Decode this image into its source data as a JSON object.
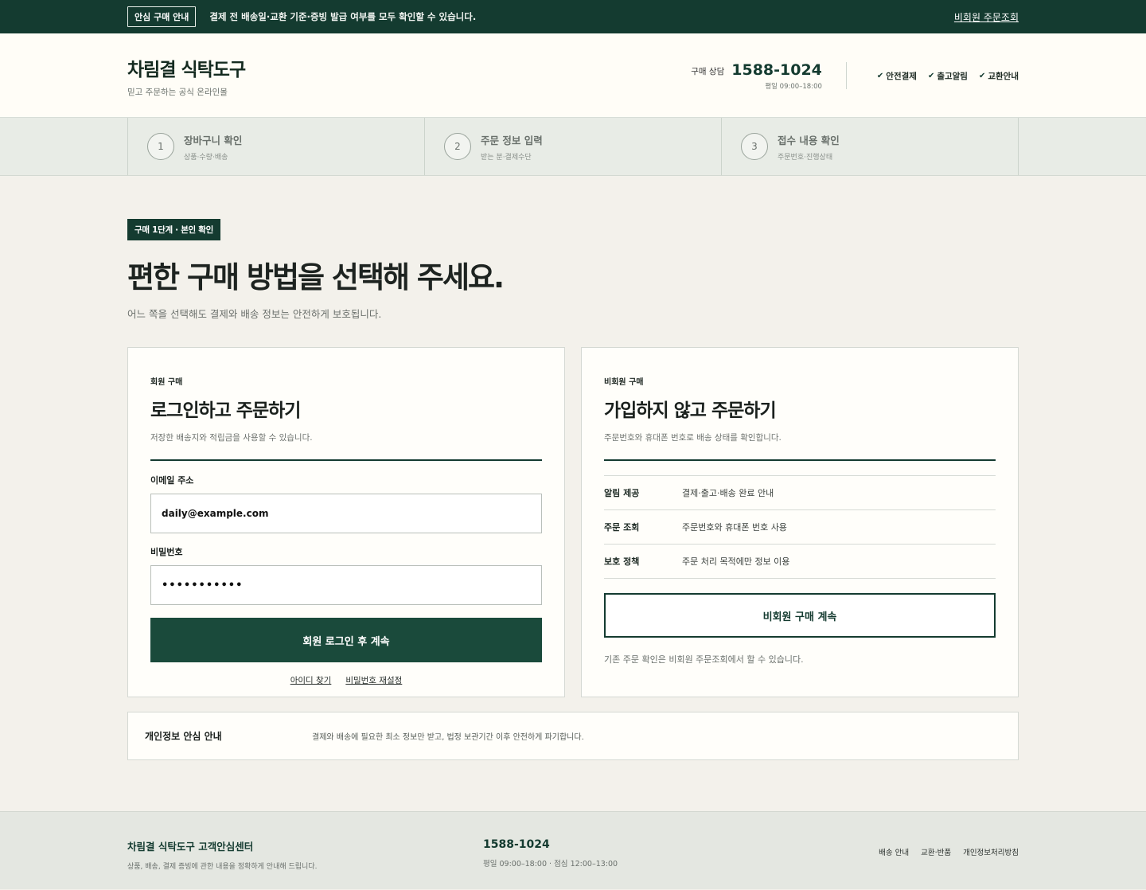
{
  "topbar": {
    "badge": "안심 구매 안내",
    "text": "결제 전 배송일·교환 기준·증빙 발급 여부를 모두 확인할 수 있습니다.",
    "link": "비회원 주문조회"
  },
  "header": {
    "brand_name": "차림결 식탁도구",
    "brand_sub": "믿고 주문하는 공식 온라인몰",
    "contact_label": "구매 상담",
    "contact_number": "1588-1024",
    "contact_hours": "평일 09:00–18:00",
    "checks": [
      "안전결제",
      "출고알림",
      "교환안내"
    ]
  },
  "steps": [
    {
      "num": "1",
      "title": "장바구니 확인",
      "sub": "상품·수량·배송"
    },
    {
      "num": "2",
      "title": "주문 정보 입력",
      "sub": "받는 분·결제수단"
    },
    {
      "num": "3",
      "title": "접수 내용 확인",
      "sub": "주문번호·진행상태"
    }
  ],
  "main": {
    "stage_badge": "구매 1단계 · 본인 확인",
    "title": "편한 구매 방법을 선택해 주세요.",
    "subtitle": "어느 쪽을 선택해도 결제와 배송 정보는 안전하게 보호됩니다."
  },
  "member": {
    "eyebrow": "회원 구매",
    "title": "로그인하고 주문하기",
    "desc": "저장한 배송지와 적립금을 사용할 수 있습니다.",
    "email_label": "이메일 주소",
    "email_value": "daily@example.com",
    "password_label": "비밀번호",
    "password_value": "•••••••••••",
    "submit_label": "회원 로그인 후 계속",
    "find_id": "아이디 찾기",
    "reset_pw": "비밀번호 재설정"
  },
  "guest": {
    "eyebrow": "비회원 구매",
    "title": "가입하지 않고 주문하기",
    "desc": "주문번호와 휴대폰 번호로 배송 상태를 확인합니다.",
    "rows": [
      {
        "key": "알림 제공",
        "value": "결제·출고·배송 완료 안내"
      },
      {
        "key": "주문 조회",
        "value": "주문번호와 휴대폰 번호 사용"
      },
      {
        "key": "보호 정책",
        "value": "주문 처리 목적에만 정보 이용"
      }
    ],
    "button_label": "비회원 구매 계속",
    "note": "기존 주문 확인은 비회원 주문조회에서 할 수 있습니다."
  },
  "privacy": {
    "title": "개인정보 안심 안내",
    "text": "결제와 배송에 필요한 최소 정보만 받고, 법정 보관기간 이후 안전하게 파기합니다."
  },
  "footer": {
    "title": "차림결 식탁도구 고객안심센터",
    "sub": "상품, 배송, 결제 증빙에 관한 내용을 정확하게 안내해 드립니다.",
    "number": "1588-1024",
    "hours": "평일 09:00–18:00 · 점심 12:00–13:00",
    "links": [
      "배송 안내",
      "교환·반품",
      "개인정보처리방침"
    ]
  },
  "colors": {
    "brand_dark": "#143b30",
    "primary_button": "#1a4a3b",
    "page_bg": "#f3f1eb"
  }
}
